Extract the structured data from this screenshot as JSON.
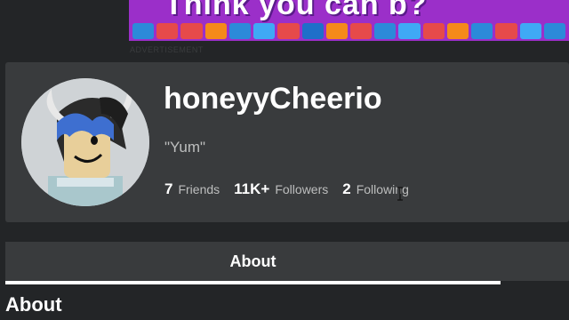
{
  "ad": {
    "banner_text": "Think you can b?",
    "label": "ADVERTISEMENT",
    "cell_colors": [
      "#2c8ad9",
      "#e64a4a",
      "#e64a4a",
      "#f58a1a",
      "#2c8ad9",
      "#3fa9f5",
      "#e64a4a",
      "#1f6fc9",
      "#f58a1a",
      "#e64a4a",
      "#2c8ad9",
      "#3fa9f5",
      "#e64a4a",
      "#f58a1a",
      "#2c8ad9",
      "#e64a4a",
      "#3fa9f5",
      "#2c8ad9"
    ]
  },
  "profile": {
    "username": "honeyyCheerio",
    "status": "\"Yum\"",
    "avatar_icon": "avatar-headshot"
  },
  "stats": {
    "friends_count": "7",
    "friends_label": "Friends",
    "followers_count": "11K+",
    "followers_label": "Followers",
    "following_count": "2",
    "following_label": "Following"
  },
  "tabs": {
    "about_label": "About"
  },
  "section": {
    "about_title": "About"
  },
  "colors": {
    "background": "#232527",
    "card": "#393b3d",
    "secondary_text": "#bdbebe",
    "ad_purple": "#9b2fc9"
  }
}
